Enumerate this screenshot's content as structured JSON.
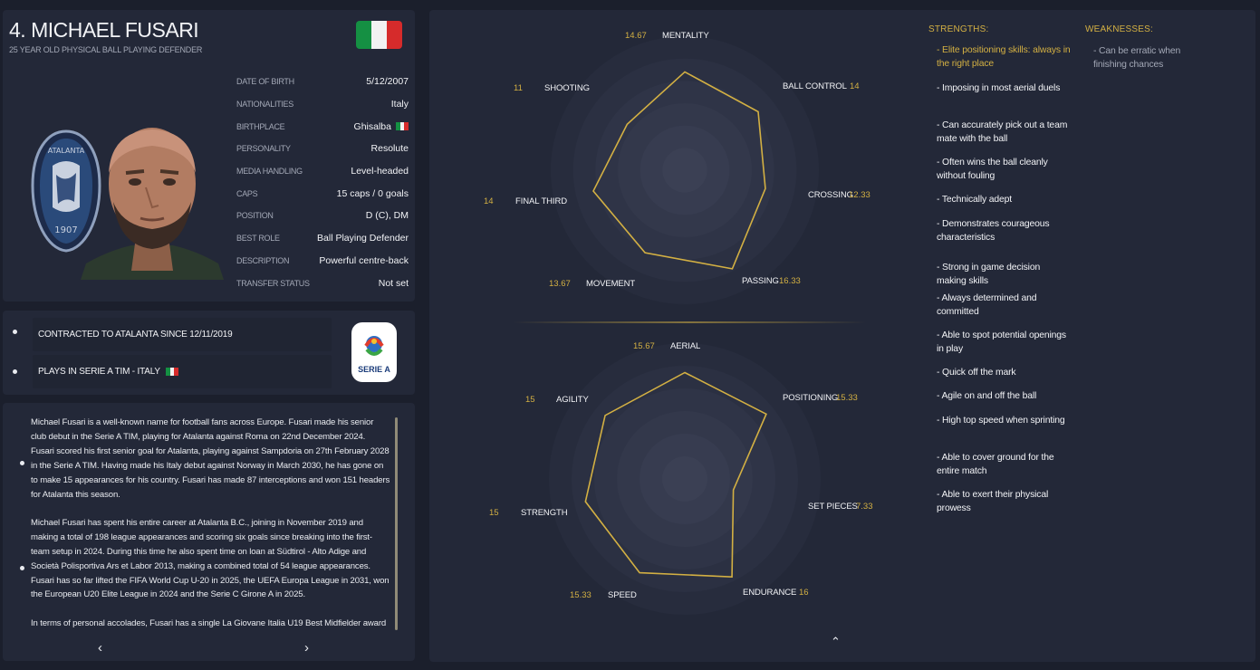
{
  "player": {
    "name": "4. MICHAEL FUSARI",
    "subtitle": "25 YEAR OLD PHYSICAL BALL PLAYING DEFENDER",
    "flag_colors": [
      "#159043",
      "#f2f2f2",
      "#d62b2b"
    ],
    "club_badge": {
      "name": "ATALANTA",
      "year": "1907"
    }
  },
  "info": [
    {
      "label": "DATE OF BIRTH",
      "value": "5/12/2007"
    },
    {
      "label": "NATIONALITIES",
      "value": "Italy"
    },
    {
      "label": "BIRTHPLACE",
      "value": "Ghisalba",
      "flag": true
    },
    {
      "label": "PERSONALITY",
      "value": "Resolute"
    },
    {
      "label": "MEDIA HANDLING",
      "value": "Level-headed"
    },
    {
      "label": "CAPS",
      "value": "15 caps / 0 goals"
    },
    {
      "label": "POSITION",
      "value": "D (C), DM"
    },
    {
      "label": "BEST ROLE",
      "value": "Ball Playing Defender"
    },
    {
      "label": "DESCRIPTION",
      "value": "Powerful centre-back"
    },
    {
      "label": "TRANSFER STATUS",
      "value": "Not set"
    }
  ],
  "contract": {
    "line1": "CONTRACTED TO ATALANTA SINCE 12/11/2019",
    "line2": "PLAYS IN SERIE A TIM - ITALY",
    "league_logo_text": "SERIE A"
  },
  "bio": {
    "paragraphs": [
      "Michael Fusari is a well-known name for football fans across Europe. Fusari made his senior club debut in the Serie A TIM, playing for Atalanta against Roma on 22nd December 2024. Fusari scored his first senior goal for Atalanta, playing against Sampdoria on 27th February 2028 in the Serie A TIM. Having made his Italy debut against Norway in March 2030, he has gone on to make 15 appearances for his country. Fusari has made 87 interceptions and won 151 headers for Atalanta this season.",
      "Michael Fusari has spent his entire career at Atalanta B.C., joining in November 2019 and making a total of 198 league appearances and scoring six goals since breaking into the first-team setup in 2024. During this time he also spent time on loan at Südtirol - Alto Adige and Società Polisportiva Ars et Labor 2013, making a combined total of 54 league appearances. Fusari has so far lifted the FIFA World Cup U-20 in 2025, the UEFA Europa League in 2031, won the European U20 Elite League in 2024 and the Serie C Girone A in 2025.",
      "In terms of personal accolades, Fusari has a single La Giovane Italia U19 Best Midfielder award"
    ],
    "prev_label": "‹",
    "next_label": "›"
  },
  "radar_max": 20,
  "radar_color": "#d3b043",
  "radar_attacking": [
    {
      "label": "MENTALITY",
      "value": 14.67,
      "display": "14.67"
    },
    {
      "label": "BALL CONTROL",
      "value": 14,
      "display": "14"
    },
    {
      "label": "CROSSING",
      "value": 12.33,
      "display": "12.33"
    },
    {
      "label": "PASSING",
      "value": 16.33,
      "display": "16.33"
    },
    {
      "label": "MOVEMENT",
      "value": 13.67,
      "display": "13.67"
    },
    {
      "label": "FINAL THIRD",
      "value": 14,
      "display": "14"
    },
    {
      "label": "SHOOTING",
      "value": 11,
      "display": "11"
    }
  ],
  "radar_physical": [
    {
      "label": "AERIAL",
      "value": 15.67,
      "display": "15.67"
    },
    {
      "label": "POSITIONING",
      "value": 15.33,
      "display": "15.33"
    },
    {
      "label": "SET PIECES",
      "value": 7.33,
      "display": "7.33"
    },
    {
      "label": "ENDURANCE",
      "value": 16,
      "display": "16"
    },
    {
      "label": "SPEED",
      "value": 15.33,
      "display": "15.33"
    },
    {
      "label": "STRENGTH",
      "value": 15,
      "display": "15"
    },
    {
      "label": "AGILITY",
      "value": 15,
      "display": "15"
    }
  ],
  "strengths_title": "STRENGTHS:",
  "weaknesses_title": "WEAKNESSES:",
  "strengths": [
    "- Elite positioning skills: always in the right place",
    "- Imposing in most aerial duels",
    "- Can accurately pick out a team mate with the ball",
    "- Often wins the ball cleanly without fouling",
    "- Technically adept",
    "- Demonstrates courageous characteristics",
    "- Strong in game decision making skills",
    "- Always determined and committed",
    "- Able to spot potential openings in play",
    "- Quick off the mark",
    "- Agile on and off the ball",
    "- High top speed when sprinting",
    "- Able to cover ground for the entire match",
    "- Able to exert their physical prowess"
  ],
  "weaknesses": [
    "- Can be erratic when finishing chances"
  ],
  "collapse_label": "⌃"
}
